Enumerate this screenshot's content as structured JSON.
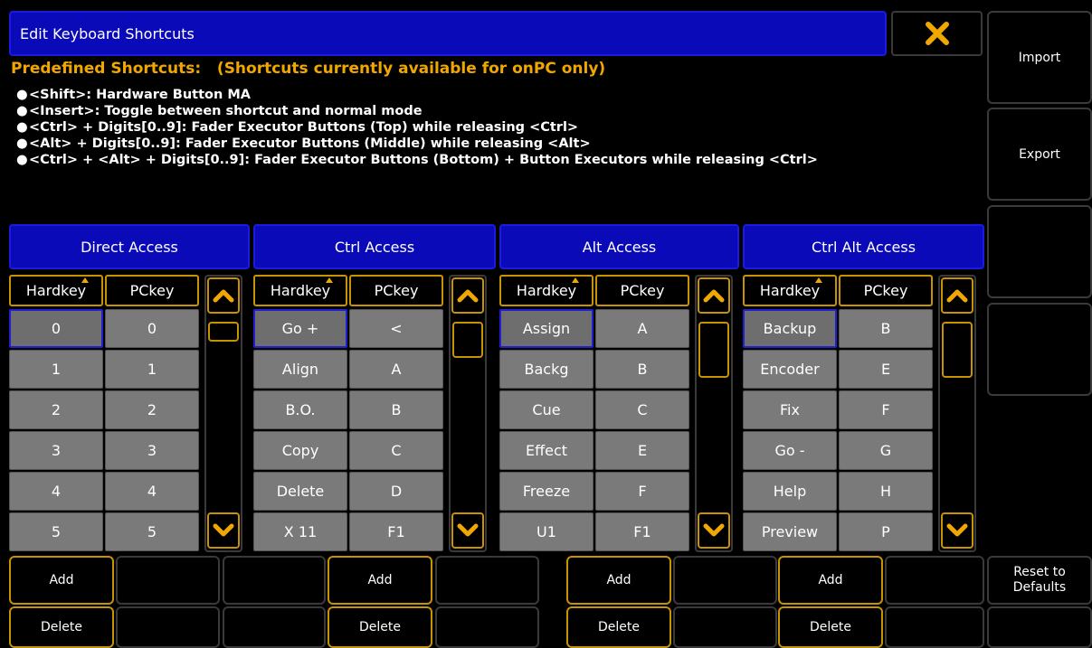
{
  "window": {
    "title": "Edit Keyboard Shortcuts",
    "close_icon": "close-x-icon"
  },
  "side": {
    "import": "Import",
    "export": "Export",
    "reset": "Reset to Defaults"
  },
  "predefined": {
    "heading": "Predefined Shortcuts:",
    "note": "(Shortcuts currently available for onPC only)",
    "items": [
      "<Shift>: Hardware Button MA",
      "<Insert>: Toggle between shortcut and normal mode",
      "<Ctrl> + Digits[0..9]: Fader Executor Buttons (Top) while releasing <Ctrl>",
      "<Alt> + Digits[0..9]: Fader Executor Buttons (Middle) while releasing <Alt>",
      "<Ctrl> + <Alt> + Digits[0..9]: Fader Executor Buttons (Bottom) + Button Executors while releasing <Ctrl>"
    ]
  },
  "columns": {
    "hardkey": "Hardkey",
    "pckey": "PCkey"
  },
  "sections": [
    {
      "title": "Direct Access",
      "rows": [
        [
          "0",
          "0"
        ],
        [
          "1",
          "1"
        ],
        [
          "2",
          "2"
        ],
        [
          "3",
          "3"
        ],
        [
          "4",
          "4"
        ],
        [
          "5",
          "5"
        ]
      ]
    },
    {
      "title": "Ctrl Access",
      "rows": [
        [
          "Go +",
          "<"
        ],
        [
          "Align",
          "A"
        ],
        [
          "B.O.",
          "B"
        ],
        [
          "Copy",
          "C"
        ],
        [
          "Delete",
          "D"
        ],
        [
          "X 11",
          "F1"
        ]
      ]
    },
    {
      "title": "Alt Access",
      "rows": [
        [
          "Assign",
          "A"
        ],
        [
          "Backg",
          "B"
        ],
        [
          "Cue",
          "C"
        ],
        [
          "Effect",
          "E"
        ],
        [
          "Freeze",
          "F"
        ],
        [
          "U1",
          "F1"
        ]
      ]
    },
    {
      "title": "Ctrl Alt Access",
      "rows": [
        [
          "Backup",
          "B"
        ],
        [
          "Encoder",
          "E"
        ],
        [
          "Fix",
          "F"
        ],
        [
          "Go -",
          "G"
        ],
        [
          "Help",
          "H"
        ],
        [
          "Preview",
          "P"
        ]
      ]
    }
  ],
  "buttons": {
    "add": "Add",
    "delete": "Delete"
  },
  "colors": {
    "title_bg": "#0a0ab8",
    "accent": "#f0a800",
    "cell_bg": "#7a7a7a",
    "border_gold": "#c79300"
  }
}
